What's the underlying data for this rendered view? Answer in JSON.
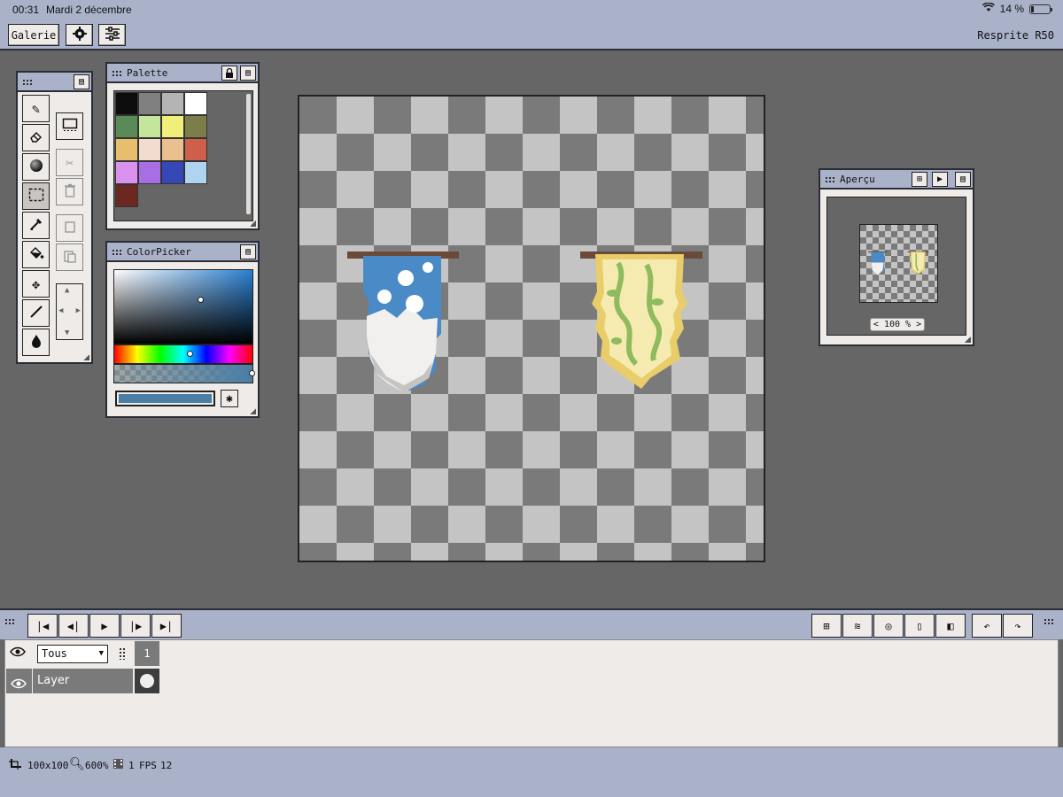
{
  "status_bar": {
    "time": "00:31",
    "date": "Mardi 2 décembre",
    "battery": "14 %",
    "battery_level": 0.14
  },
  "toolbar": {
    "gallery_label": "Galerie",
    "settings_icon": "gear-icon",
    "adjust_icon": "sliders-icon",
    "document_title": "Resprite R50"
  },
  "tools_panel": {
    "tools": [
      "pencil-icon",
      "eraser-icon",
      "shade-ball-icon",
      "selection-icon",
      "eyedropper-icon",
      "fill-bucket-icon",
      "move-icon",
      "line-icon",
      "drop-icon"
    ],
    "selected_tool": "selection-icon",
    "actions": [
      "transform-icon",
      "cut-icon",
      "trash-icon",
      "copy-icon",
      "paste-icon"
    ]
  },
  "palette": {
    "title": "Palette",
    "colors": [
      "#0d0d0d",
      "#808080",
      "#b4b4b4",
      "#ffffff",
      "#5a8a55",
      "#c3e69c",
      "#f0ef7a",
      "#7d7d4a",
      "#e6be6e",
      "#f2dbcf",
      "#e9c08e",
      "#cf5f4a",
      "#d891ec",
      "#a86ee4",
      "#3648b8",
      "#aed4f0",
      "#6b2820"
    ]
  },
  "color_picker": {
    "title": "ColorPicker",
    "current_color": "#4a7ea6"
  },
  "canvas": {
    "size_label": "100x100",
    "banners": [
      {
        "name": "blue-banner",
        "colors": [
          "#4a8ac6",
          "#f2f0ee",
          "#6b4a3a"
        ]
      },
      {
        "name": "yellow-vine-banner",
        "colors": [
          "#f2e7a4",
          "#e8cd6a",
          "#8fba5e",
          "#6b4a3a"
        ]
      }
    ]
  },
  "preview_panel": {
    "title": "Aperçu",
    "zoom_label": "< 100 % >"
  },
  "timeline": {
    "playback": [
      "first-frame-icon",
      "previous-frame-icon",
      "play-icon",
      "next-frame-icon",
      "last-frame-icon"
    ],
    "tools": [
      "grid-icon",
      "layers-icon",
      "onion-skin-icon",
      "frame-icon",
      "mirror-icon",
      "undo-icon",
      "redo-icon"
    ]
  },
  "layers": {
    "filter_value": "Tous",
    "frame_number": "1",
    "layer_name": "Layer"
  },
  "footer": {
    "size": "100x100",
    "zoom": "600%",
    "frames": "1",
    "fps_label": "FPS",
    "fps": "12"
  }
}
